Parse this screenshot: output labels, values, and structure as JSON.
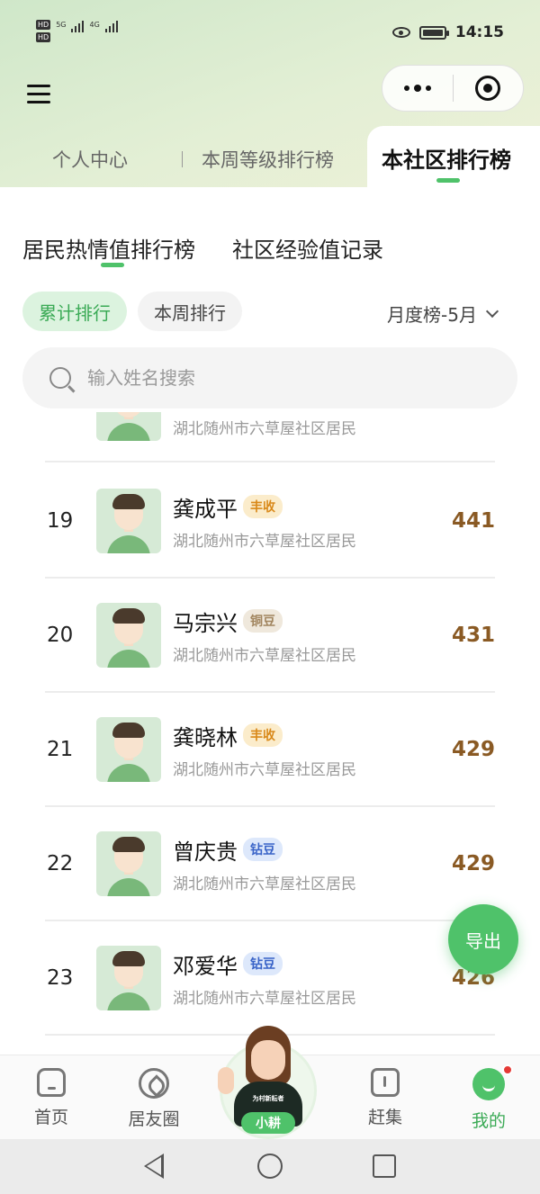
{
  "status_bar": {
    "hd1": "HD",
    "hd2": "HD",
    "net1": "5G",
    "net2": "4G",
    "time": "14:15"
  },
  "top_tabs": [
    {
      "label": "个人中心"
    },
    {
      "label": "本周等级排行榜"
    },
    {
      "label": "本社区排行榜",
      "active": true
    }
  ],
  "section_tabs": [
    {
      "label": "居民热情值排行榜",
      "active": true
    },
    {
      "label": "社区经验值记录"
    }
  ],
  "filters": {
    "pills": [
      {
        "label": "累计排行",
        "active": true
      },
      {
        "label": "本周排行"
      }
    ],
    "month_select": "月度榜-5月"
  },
  "search": {
    "placeholder": "输入姓名搜索",
    "value": ""
  },
  "list": {
    "partial_top_address": "湖北随州市六草屋社区居民",
    "rows": [
      {
        "rank": "19",
        "name": "龚成平",
        "badge": "丰收",
        "badge_type": "fengshou",
        "address": "湖北随州市六草屋社区居民",
        "score": "441"
      },
      {
        "rank": "20",
        "name": "马宗兴",
        "badge": "铜豆",
        "badge_type": "tongdou",
        "address": "湖北随州市六草屋社区居民",
        "score": "431"
      },
      {
        "rank": "21",
        "name": "龚晓林",
        "badge": "丰收",
        "badge_type": "fengshou",
        "address": "湖北随州市六草屋社区居民",
        "score": "429"
      },
      {
        "rank": "22",
        "name": "曾庆贵",
        "badge": "钻豆",
        "badge_type": "zuandou",
        "address": "湖北随州市六草屋社区居民",
        "score": "429"
      },
      {
        "rank": "23",
        "name": "邓爱华",
        "badge": "钻豆",
        "badge_type": "zuandou",
        "address": "湖北随州市六草屋社区居民",
        "score": "426"
      }
    ]
  },
  "export_button": "导出",
  "bottom_nav": {
    "home": "首页",
    "circle": "居友圈",
    "assistant": "小耕",
    "assistant_shirt": "为村新耘者",
    "market": "赶集",
    "mine": "我的"
  },
  "colors": {
    "accent": "#4fc26a",
    "score": "#8a5a24",
    "notification": "#e53935"
  }
}
